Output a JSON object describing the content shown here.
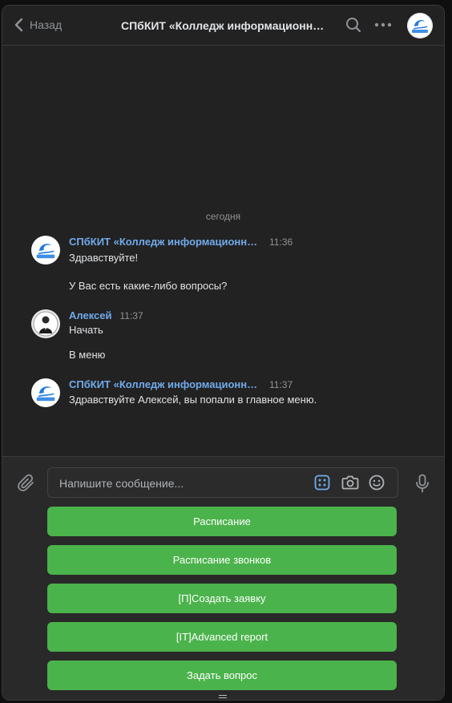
{
  "header": {
    "back_label": "Назад",
    "title": "СПбКИТ «Колледж информационны..."
  },
  "feed": {
    "date_separator": "сегодня",
    "messages": [
      {
        "author": "СПбКИТ «Колледж информационных ...",
        "time": "11:36",
        "lines": [
          "Здравствуйте!",
          "У Вас есть какие-либо вопросы?"
        ]
      },
      {
        "author": "Алексей",
        "time": "11:37",
        "lines": [
          "Начать",
          "В меню"
        ]
      },
      {
        "author": "СПбКИТ «Колледж информационных ...",
        "time": "11:37",
        "lines": [
          "Здравствуйте Алексей, вы попали в главное меню."
        ]
      }
    ]
  },
  "composer": {
    "placeholder": "Напишите сообщение..."
  },
  "keyboard": {
    "buttons": [
      "Расписание",
      "Расписание звонков",
      "[П]Создать заявку",
      "[IT]Advanced report",
      "Задать вопрос"
    ]
  },
  "colors": {
    "accent_button": "#4bb34b",
    "author_link": "#71aaeb",
    "background": "#222222"
  },
  "icons": {
    "back": "chevron-left-icon",
    "search": "search-icon",
    "more": "more-horizontal-icon",
    "attach": "paperclip-icon",
    "keyboard": "bot-keyboard-icon",
    "camera": "camera-icon",
    "emoji": "smile-icon",
    "mic": "microphone-icon"
  }
}
